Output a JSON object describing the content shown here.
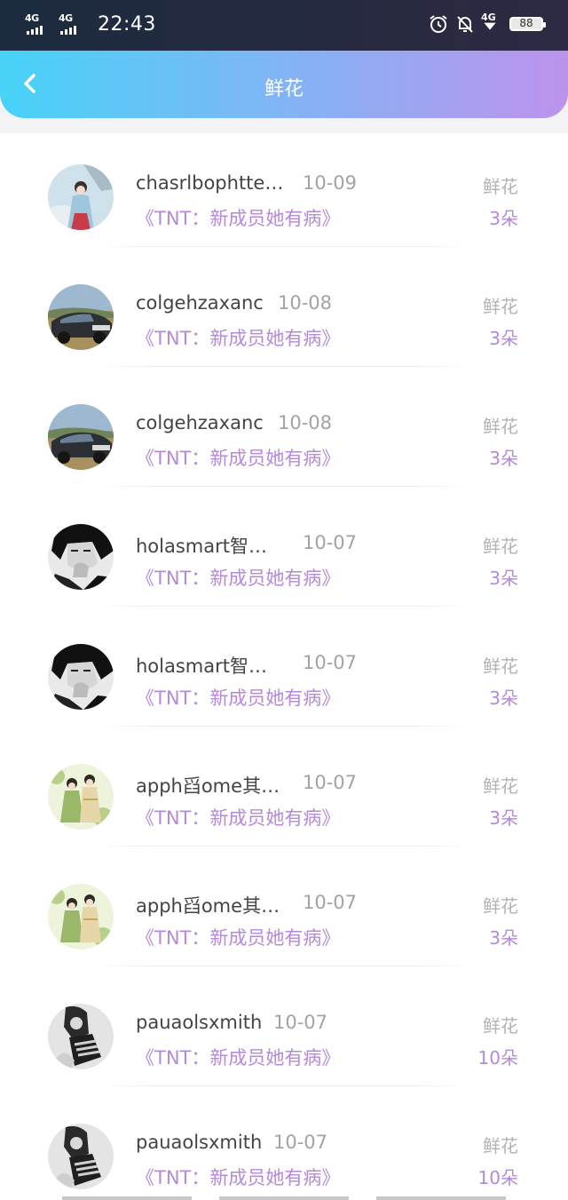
{
  "status_bar": {
    "signal_1": "4G",
    "signal_2": "4G",
    "time": "22:43",
    "icons": [
      "alarm-icon",
      "mute-icon",
      "wifi-4g-icon"
    ],
    "network_small": "4G",
    "battery": "88"
  },
  "nav": {
    "title": "鲜花",
    "back_icon": "chevron-left-icon"
  },
  "colors": {
    "accent_purple": "#b48ad9",
    "nav_gradient_start": "#47d3f7",
    "nav_gradient_end": "#bd93ec"
  },
  "items": [
    {
      "name": "chasrlbophtte…",
      "date": "10-09",
      "book": "《TNT：新成员她有病》",
      "gift": "鲜花",
      "count": "3朵",
      "avatar": "girl-hanfu"
    },
    {
      "name": "colgehzaxanc",
      "date": "10-08",
      "book": "《TNT：新成员她有病》",
      "gift": "鲜花",
      "count": "3朵",
      "avatar": "car"
    },
    {
      "name": "colgehzaxanc",
      "date": "10-08",
      "book": "《TNT：新成员她有病》",
      "gift": "鲜花",
      "count": "3朵",
      "avatar": "car"
    },
    {
      "name": "holasmart智…",
      "date": "10-07",
      "book": "《TNT：新成员她有病》",
      "gift": "鲜花",
      "count": "3朵",
      "avatar": "bw-boy"
    },
    {
      "name": "holasmart智…",
      "date": "10-07",
      "book": "《TNT：新成员她有病》",
      "gift": "鲜花",
      "count": "3朵",
      "avatar": "bw-boy"
    },
    {
      "name": "apph舀ome其…",
      "date": "10-07",
      "book": "《TNT：新成员她有病》",
      "gift": "鲜花",
      "count": "3朵",
      "avatar": "anime-couple"
    },
    {
      "name": "apph舀ome其…",
      "date": "10-07",
      "book": "《TNT：新成员她有病》",
      "gift": "鲜花",
      "count": "3朵",
      "avatar": "anime-couple"
    },
    {
      "name": "pauaolsxmith",
      "date": "10-07",
      "book": "《TNT：新成员她有病》",
      "gift": "鲜花",
      "count": "10朵",
      "avatar": "bw-girl"
    },
    {
      "name": "pauaolsxmith",
      "date": "10-07",
      "book": "《TNT：新成员她有病》",
      "gift": "鲜花",
      "count": "10朵",
      "avatar": "bw-girl"
    }
  ]
}
